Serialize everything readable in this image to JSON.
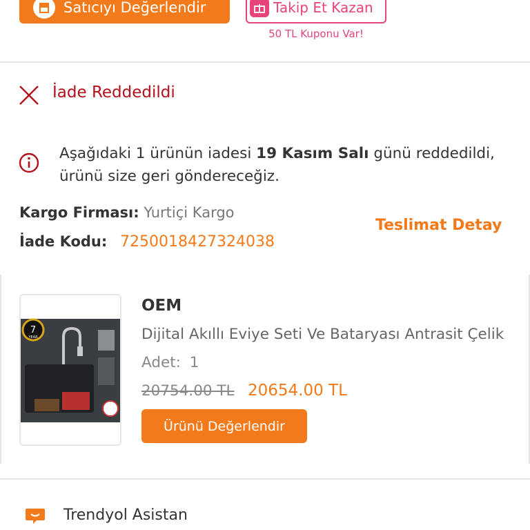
{
  "actions": {
    "rate_seller_label": "Satıcıyı Değerlendir",
    "follow_label": "Takip Et Kazan",
    "coupon_text": "50 TL Kuponu Var!"
  },
  "status": {
    "label": "İade Reddedildi"
  },
  "notice": {
    "part1": "Aşağıdaki 1 ürünün iadesi ",
    "date_bold": "19 Kasım Salı",
    "part2": " günü reddedildi, ürünü size geri göndereceğiz."
  },
  "shipping": {
    "cargo_label": "Kargo Firması:",
    "cargo_value": "Yurtiçi Kargo",
    "return_code_label": "İade Kodu:",
    "return_code_value": "7250018427324038",
    "delivery_detail_link": "Teslimat Detay"
  },
  "product": {
    "brand": "OEM",
    "name": "Dijital Akıllı Eviye Seti Ve Bataryası Antrasit Çelik",
    "qty_label": "Adet:",
    "qty_value": "1",
    "price_old": "20754.00 TL",
    "price_new": "20654.00 TL",
    "review_button": "Ürünü Değerlendir",
    "image_badge": "7",
    "image_badge_sub": "YEAR"
  },
  "assistant": {
    "label": "Trendyol Asistan"
  },
  "colors": {
    "brand_orange": "#f27a1a",
    "pink": "#e6447a",
    "reject_red": "#b40f1c"
  }
}
